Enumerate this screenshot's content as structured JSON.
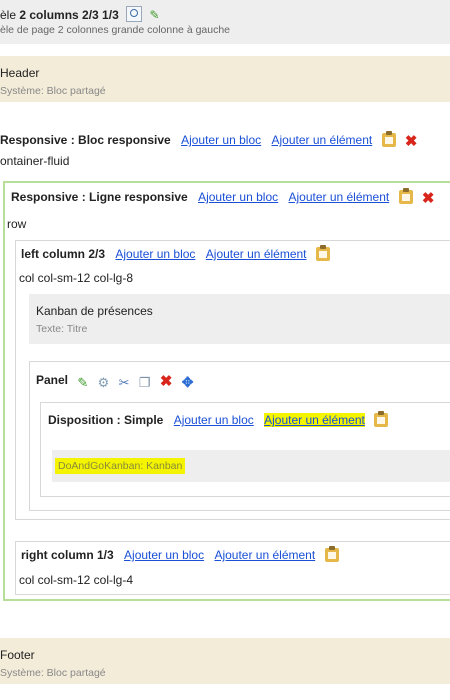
{
  "template": {
    "prefix": "èle ",
    "name": "2 columns 2/3 1/3",
    "description": "èle de page 2 colonnes grande colonne à gauche"
  },
  "header": {
    "label": "Header",
    "type": "Système: Bloc partagé"
  },
  "responsive_block": {
    "title": "Responsive : Bloc responsive",
    "add_block": "Ajouter un bloc",
    "add_element": "Ajouter un élément",
    "class": "ontainer-fluid"
  },
  "responsive_line": {
    "title": "Responsive : Ligne responsive",
    "add_block": "Ajouter un bloc",
    "add_element": "Ajouter un élément",
    "class": "row"
  },
  "left_column": {
    "title": "left column 2/3",
    "add_block": "Ajouter un bloc",
    "add_element": "Ajouter un élément",
    "class": "col col-sm-12 col-lg-8"
  },
  "kanban_title": {
    "label": "Kanban de présences",
    "type": "Texte: Titre"
  },
  "panel": {
    "title": "Panel"
  },
  "disposition": {
    "title": "Disposition : Simple",
    "add_block": "Ajouter un bloc",
    "add_element": "Ajouter un élément"
  },
  "doandgo": {
    "label": "DoAndGoKanban: Kanban"
  },
  "right_column": {
    "title": "right column 1/3",
    "add_block": "Ajouter un bloc",
    "add_element": "Ajouter un élément",
    "class": "col col-sm-12 col-lg-4"
  },
  "footer": {
    "label": "Footer",
    "type": "Système: Bloc partagé"
  },
  "colors": {
    "link": "#1a4fd6",
    "shared_block_bg": "#f3ecd9",
    "line_border": "#b8df9a",
    "highlight": "#f4f400",
    "delete": "#d9261c"
  },
  "icons": [
    "search-icon",
    "pencil-icon",
    "clipboard-icon",
    "delete-icon",
    "gear-icon",
    "tool-icon",
    "copy-icon",
    "move-icon"
  ]
}
